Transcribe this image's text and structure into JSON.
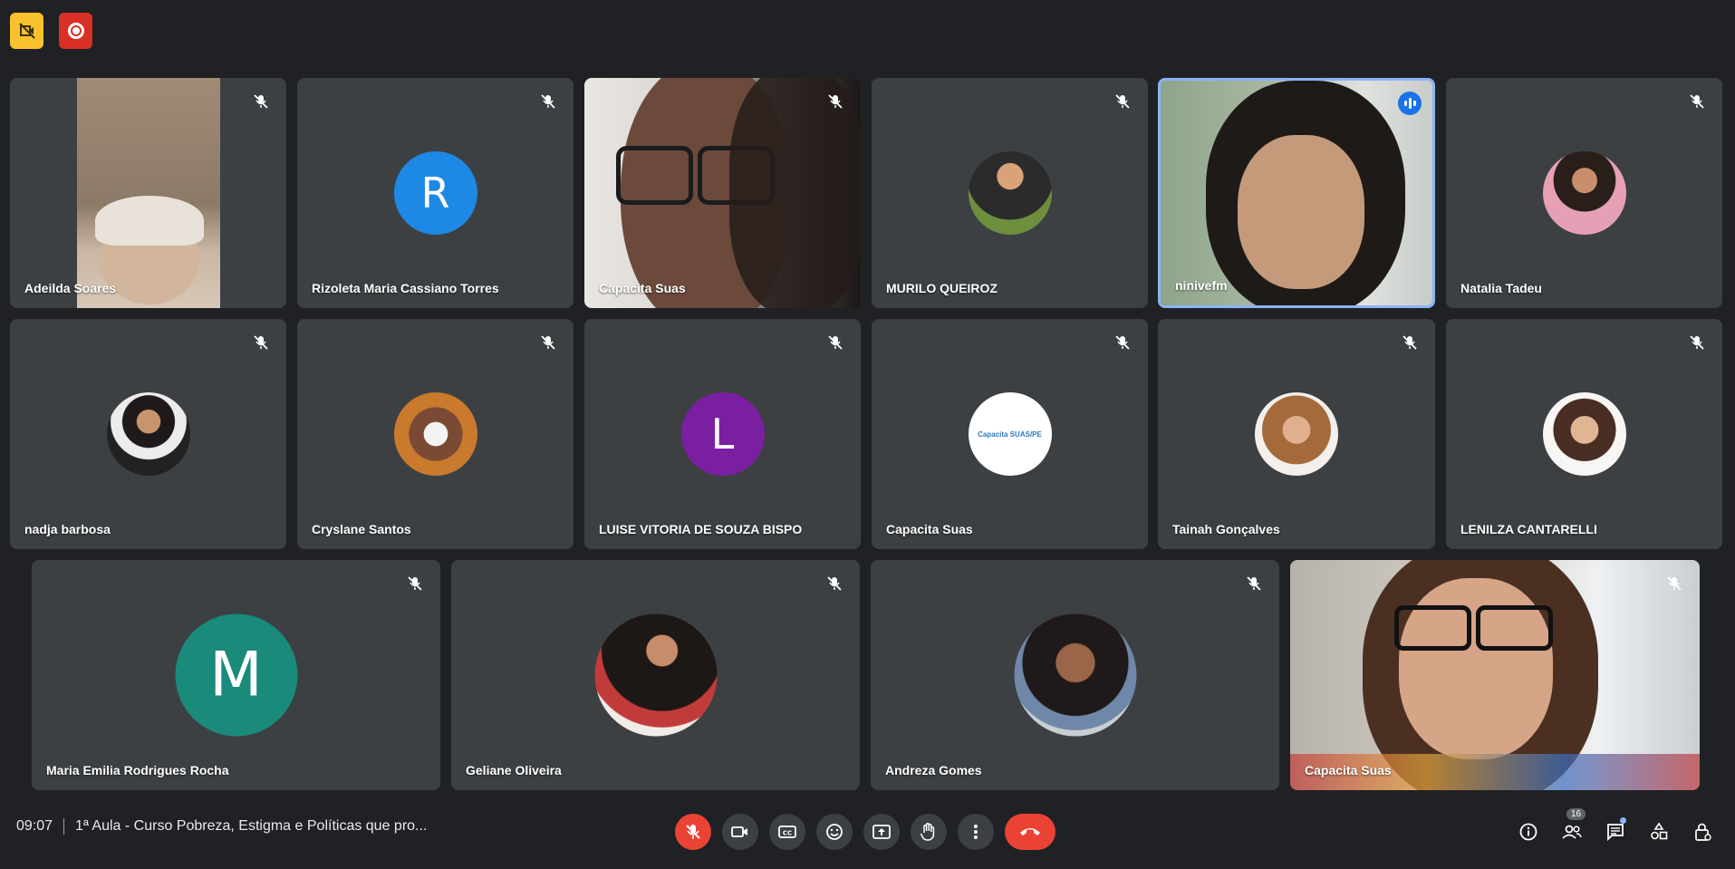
{
  "meeting": {
    "time": "09:07",
    "title": "1ª Aula - Curso Pobreza, Estigma e Políticas que pro..."
  },
  "participants_count": "16",
  "tiles": [
    {
      "name": "Adeilda Soares",
      "kind": "video"
    },
    {
      "name": "Rizoleta Maria Cassiano Torres",
      "kind": "letter",
      "letter": "R",
      "color": "#1e88e5"
    },
    {
      "name": "Capacita Suas",
      "kind": "video"
    },
    {
      "name": "MURILO QUEIROZ",
      "kind": "photo"
    },
    {
      "name": "ninivefm",
      "kind": "video",
      "speaking": true
    },
    {
      "name": "Natalia Tadeu",
      "kind": "photo"
    },
    {
      "name": "nadja barbosa",
      "kind": "photo"
    },
    {
      "name": "Cryslane Santos",
      "kind": "photo"
    },
    {
      "name": "LUISE VITORIA DE SOUZA BISPO",
      "kind": "letter",
      "letter": "L",
      "color": "#7b1fa2"
    },
    {
      "name": "Capacita Suas",
      "kind": "logo",
      "logo_text": "Capacita SUAS/PE"
    },
    {
      "name": "Tainah Gonçalves",
      "kind": "photo"
    },
    {
      "name": "LENILZA CANTARELLI",
      "kind": "photo"
    },
    {
      "name": "Maria Emilia Rodrigues Rocha",
      "kind": "letter",
      "letter": "M",
      "color": "#1a8a7a"
    },
    {
      "name": "Geliane Oliveira",
      "kind": "photo"
    },
    {
      "name": "Andreza Gomes",
      "kind": "photo"
    },
    {
      "name": "Capacita Suas",
      "kind": "video"
    }
  ],
  "colors": {
    "background": "#202124",
    "tile": "#3c4043",
    "end_call": "#ea4335",
    "active_border": "#8ab4f8"
  }
}
